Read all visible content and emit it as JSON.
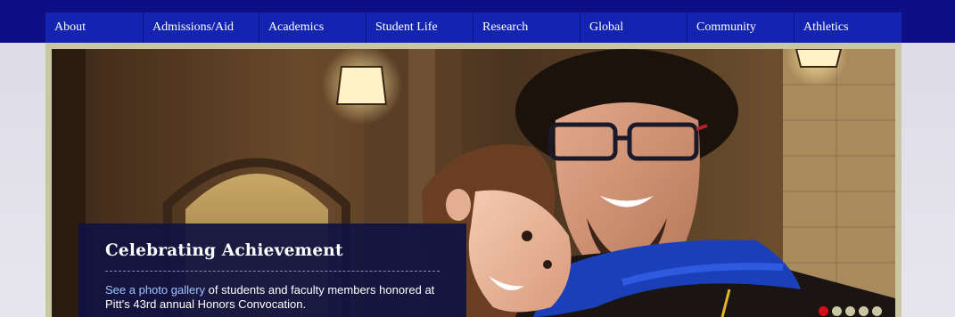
{
  "nav": {
    "items": [
      {
        "label": "About"
      },
      {
        "label": "Admissions/Aid"
      },
      {
        "label": "Academics"
      },
      {
        "label": "Student Life"
      },
      {
        "label": "Research"
      },
      {
        "label": "Global"
      },
      {
        "label": "Community"
      },
      {
        "label": "Athletics"
      }
    ]
  },
  "hero": {
    "image": "celebration-photo",
    "caption": {
      "title": "Celebrating Achievement",
      "link_text": "See a photo gallery",
      "text": " of students and faculty members honored at Pitt's 43rd annual Honors Convocation."
    },
    "slides": {
      "count": 5,
      "active_index": 0
    }
  },
  "colors": {
    "nav_bg": "#1424b0",
    "top_band": "#0c0f86",
    "active_dot": "#d30f1a",
    "inactive_dot": "#c8c9a4",
    "link": "#9fc4ff"
  }
}
